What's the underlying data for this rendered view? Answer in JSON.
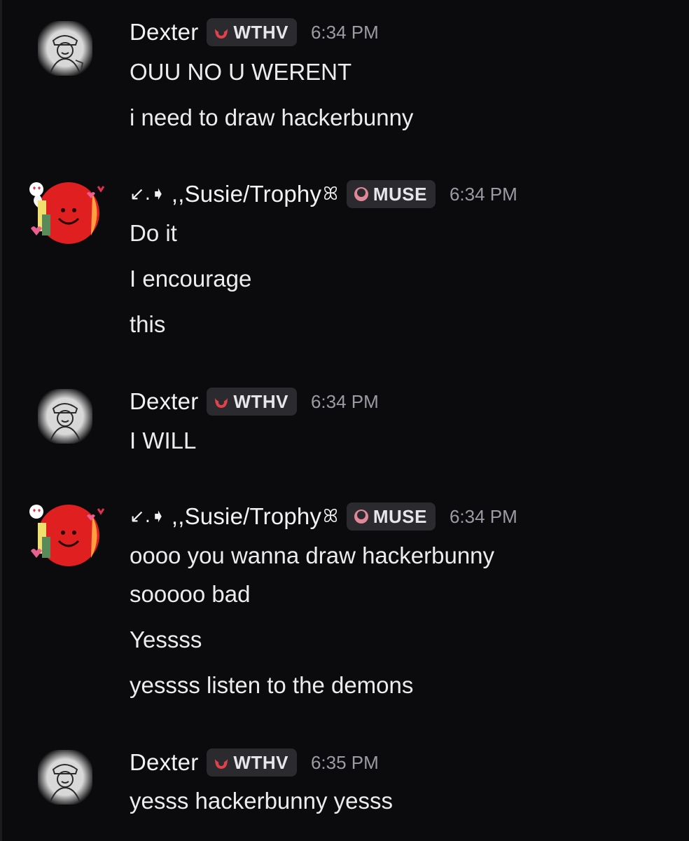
{
  "messages": [
    {
      "author": "Dexter",
      "prefix": "",
      "suffix": "",
      "tag": "WTHV",
      "time": "6:34 PM",
      "avatar": "dexter-avatar",
      "lines": [
        "OUU NO U WERENT",
        "i need to draw hackerbunny"
      ]
    },
    {
      "author": ",,Susie/Trophy",
      "prefix": "↙.➧",
      "suffix": "ꕤ",
      "tag": "MUSE",
      "time": "6:34 PM",
      "avatar": "susie-avatar",
      "lines": [
        "Do it",
        "I encourage",
        "this"
      ]
    },
    {
      "author": "Dexter",
      "prefix": "",
      "suffix": "",
      "tag": "WTHV",
      "time": "6:34 PM",
      "avatar": "dexter-avatar",
      "lines": [
        "I WILL"
      ]
    },
    {
      "author": ",,Susie/Trophy",
      "prefix": "↙.➧",
      "suffix": "ꕤ",
      "tag": "MUSE",
      "time": "6:34 PM",
      "avatar": "susie-avatar",
      "lines": [
        "oooo you wanna draw hackerbunny",
        "sooooo bad",
        "Yessss",
        "yessss listen to the demons"
      ]
    },
    {
      "author": "Dexter",
      "prefix": "",
      "suffix": "",
      "tag": "WTHV",
      "time": "6:35 PM",
      "avatar": "dexter-avatar",
      "lines": [
        "yesss hackerbunny yesss"
      ]
    }
  ],
  "colors": {
    "background": "#0b0b0d",
    "tag_background": "#2a2a2f",
    "timestamp": "#9b9ba3",
    "tag_icon": "#e0414a"
  }
}
